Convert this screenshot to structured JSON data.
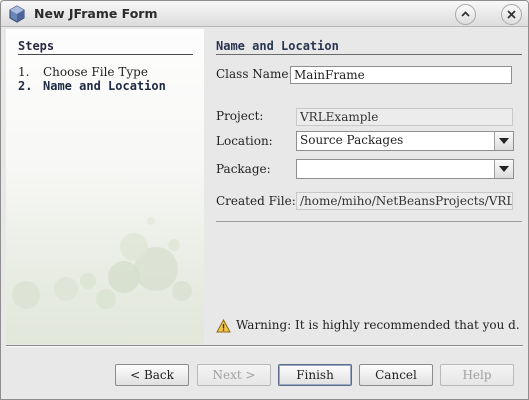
{
  "window": {
    "title": "New JFrame Form",
    "icon": "cube-icon"
  },
  "titlebar_buttons": {
    "restore_icon": "chevron-up-icon",
    "close_icon": "close-icon"
  },
  "steps": {
    "heading": "Steps",
    "items": [
      {
        "number": "1.",
        "label": "Choose File Type",
        "active": false
      },
      {
        "number": "2.",
        "label": "Name and Location",
        "active": true
      }
    ]
  },
  "section": {
    "title": "Name and Location"
  },
  "form": {
    "class_name_label": "Class Name:",
    "class_name_value": "MainFrame",
    "project_label": "Project:",
    "project_value": "VRLExample",
    "location_label": "Location:",
    "location_value": "Source Packages",
    "package_label": "Package:",
    "package_value": "",
    "created_file_label": "Created File:",
    "created_file_value": "/home/miho/NetBeansProjects/VRLExample"
  },
  "warning": {
    "icon": "warning-icon",
    "text": "Warning: It is highly recommended that you d..."
  },
  "buttons": {
    "back": "< Back",
    "next": "Next >",
    "finish": "Finish",
    "cancel": "Cancel",
    "help": "Help"
  }
}
